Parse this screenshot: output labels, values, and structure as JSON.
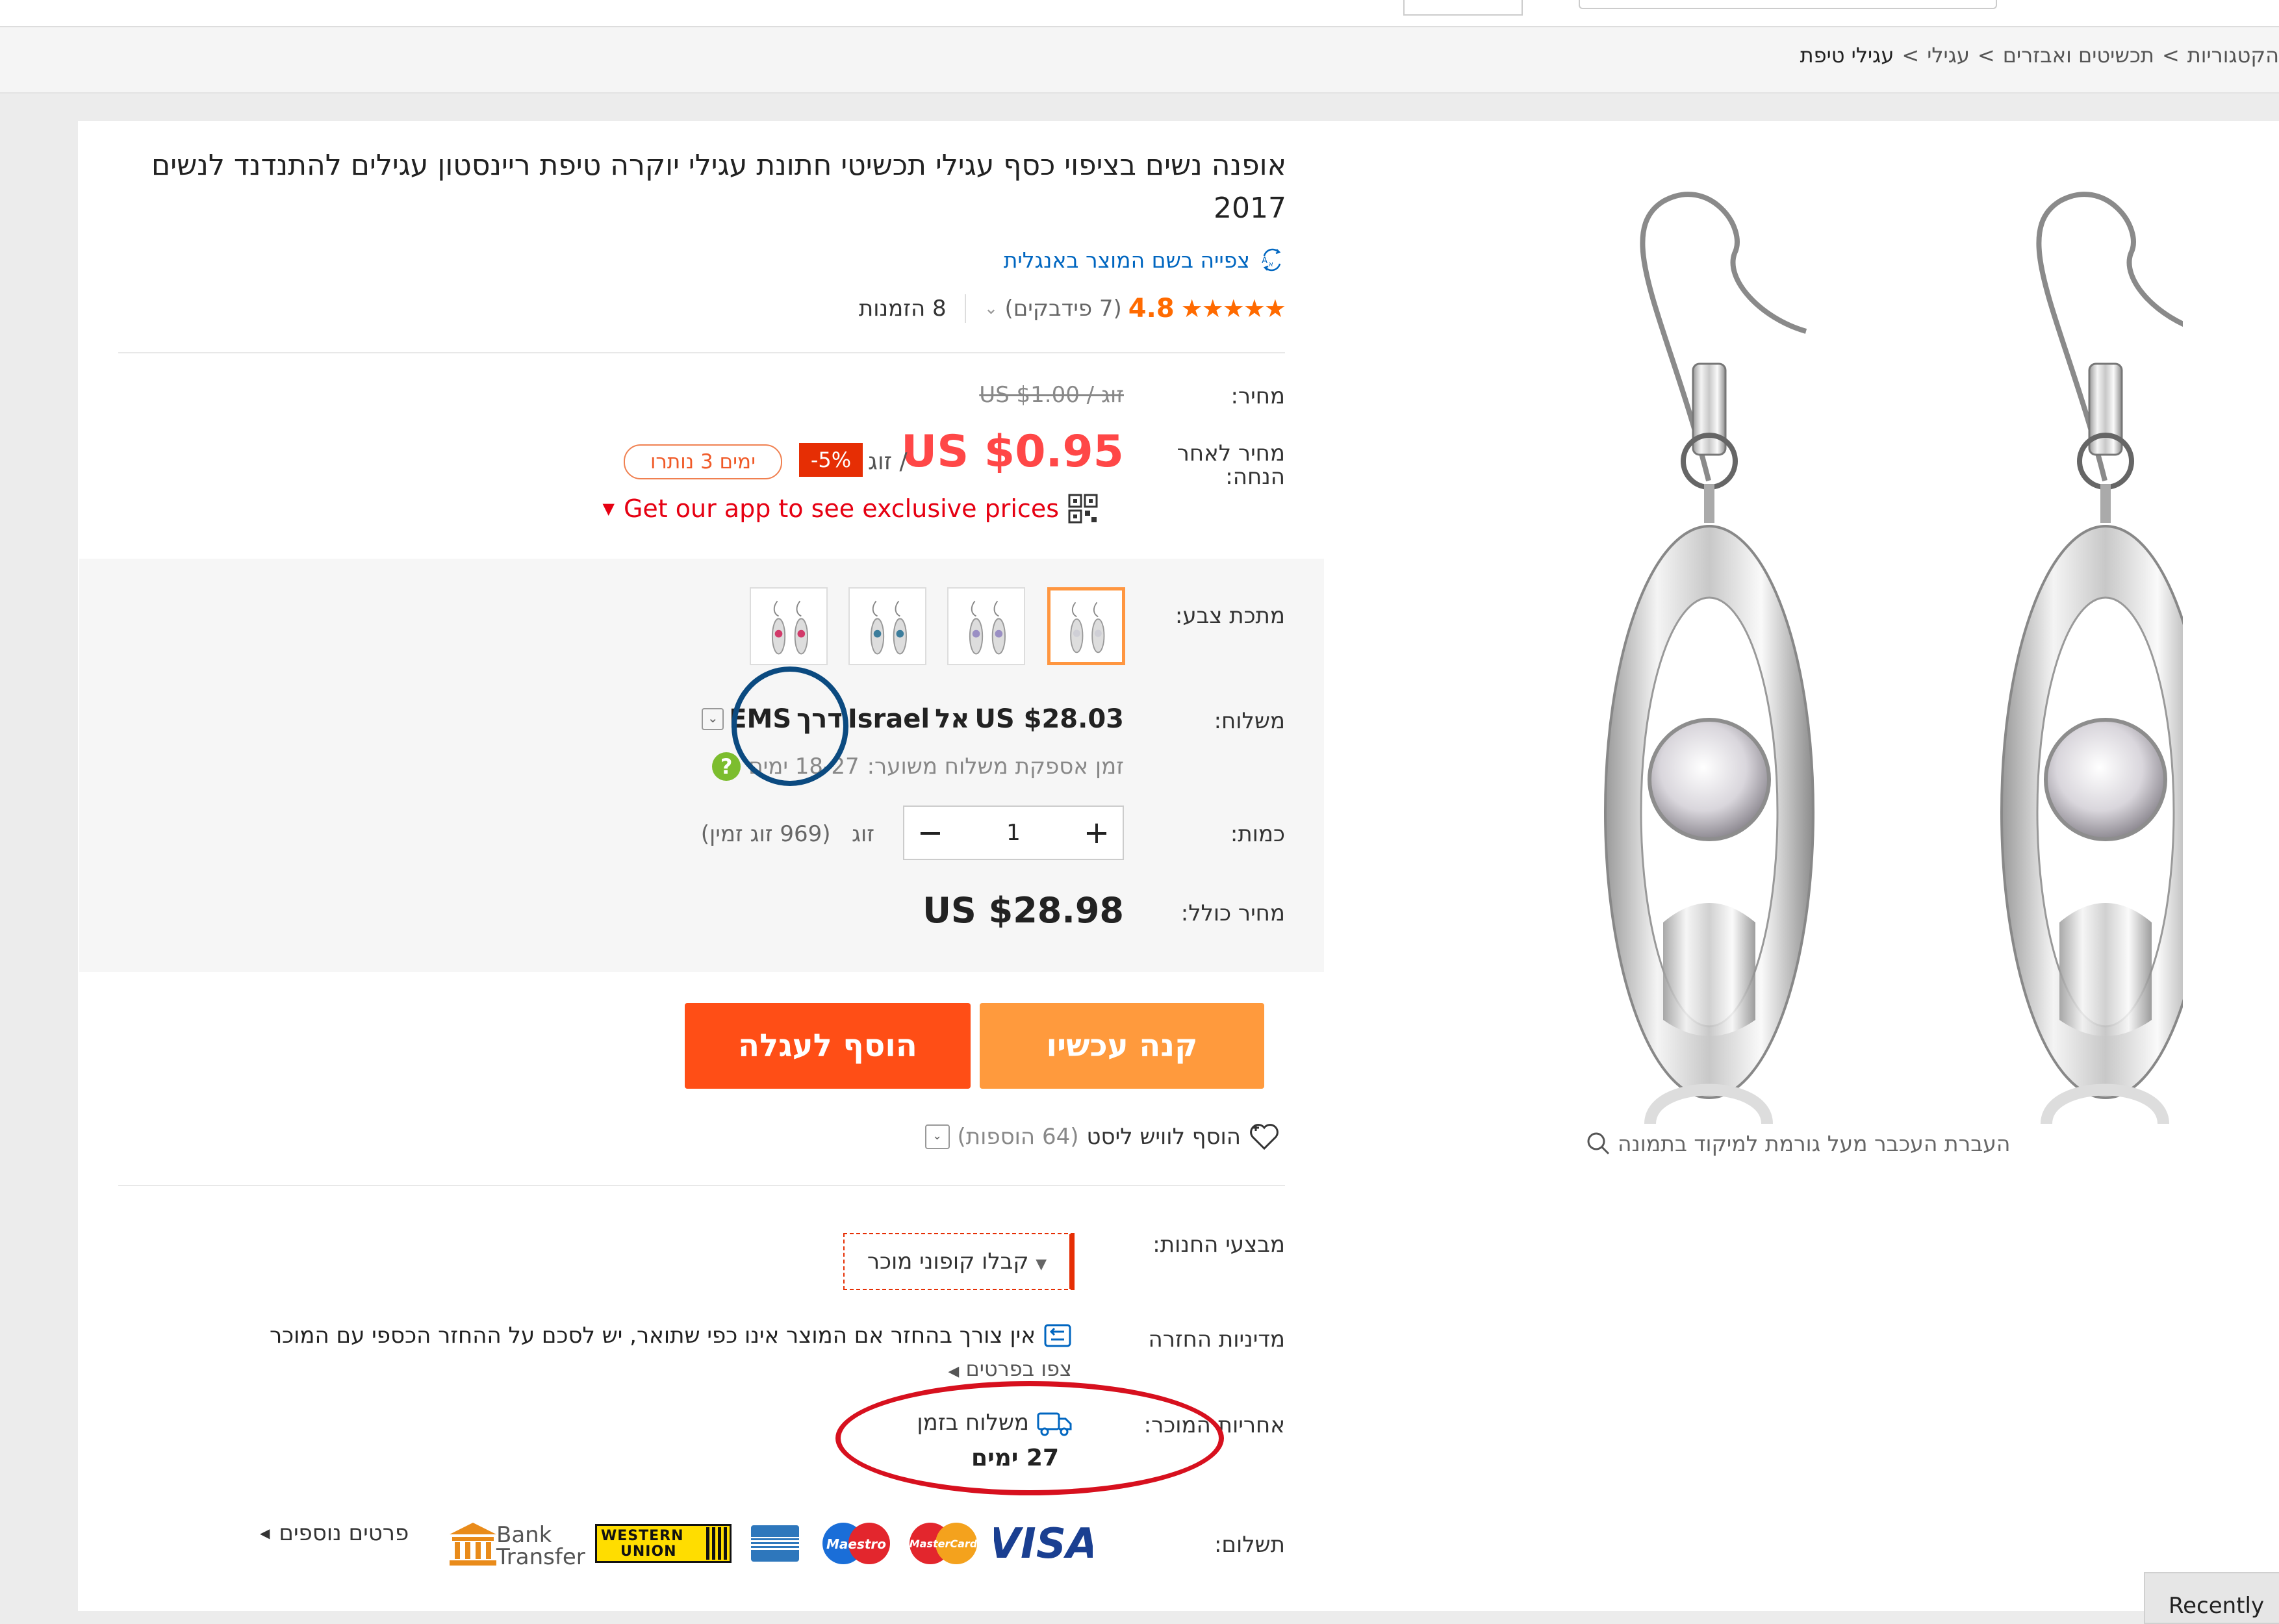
{
  "breadcrumb": {
    "items": [
      "הקטגוריות",
      "תכשיטים ואבזרים",
      "עגילי",
      "עגילי טיפת"
    ],
    "separator": ">"
  },
  "product": {
    "title": "אופנה נשים בציפוי כסף עגילי תכשיטי חתונת עגילי יוקרה טיפת ריינסטון עגילים להתנדנד לנשים 2017",
    "translate_link": "צפייה בשם המוצר באנגלית",
    "rating": {
      "stars": 4.8,
      "stars_glyph": "★★★★★",
      "score": "4.8",
      "feedback": "(7 פידבקים)",
      "orders": "8 הזמנות"
    }
  },
  "price": {
    "label": "מחיר:",
    "original": "US $1.00 / זוג",
    "discount_label": "מחיר לאחר הנחה:",
    "current": "US $0.95",
    "per_unit": "/ זוג",
    "discount_badge": "-5%",
    "days_left": "ימים 3 נותרו",
    "app_promo": "Get our app to see exclusive prices"
  },
  "color": {
    "label": "מתכת צבע:",
    "swatches": [
      {
        "name": "clear",
        "stone": "#cfcfd6",
        "selected": true
      },
      {
        "name": "purple",
        "stone": "#9a8fc4",
        "selected": false
      },
      {
        "name": "blue",
        "stone": "#3c7d9c",
        "selected": false
      },
      {
        "name": "pink",
        "stone": "#d23a6a",
        "selected": false
      }
    ]
  },
  "shipping": {
    "label": "משלוח:",
    "cost": "US $28.03",
    "to_prefix": "אל",
    "destination": "Israel",
    "via_prefix": "דרך",
    "method": "EMS",
    "time_label": "זמן אספקת משלוח משוער:",
    "time_value": "18-27 ימים"
  },
  "quantity": {
    "label": "כמות:",
    "value": "1",
    "unit": "זוג",
    "available": "(969 זוג זמין)",
    "minus": "−",
    "plus": "+"
  },
  "total": {
    "label": "מחיר כולל:",
    "value": "US $28.98"
  },
  "actions": {
    "buy_now": "קנה עכשיו",
    "add_to_cart": "הוסף לעגלה",
    "wishlist": "הוסף לוויש ליסט",
    "wishlist_count": "(64 הוספות)"
  },
  "store_promos": {
    "label": "מבצעי החנות:",
    "coupon_button": "קבלו קופוני מוכר"
  },
  "return_policy": {
    "label": "מדיניות החזרה",
    "text": "אין צורך בהחזר אם המוצר אינו כפי שתואר, יש לסכם על ההחזר הכספי עם המוכר",
    "details_link": "צפו בפרטים"
  },
  "seller_guarantee": {
    "label": "אחריות המוכר:",
    "text": "משלוח בזמן",
    "days": "27 ימים"
  },
  "payment": {
    "label": "תשלום:",
    "more_link": "פרטים נוספים",
    "methods": [
      "VISA",
      "MasterCard",
      "Maestro",
      "American Express",
      "WESTERN UNION",
      "Bank Transfer"
    ],
    "bank_line1": "Bank",
    "bank_line2": "Transfer",
    "wu_line1": "WESTERN",
    "wu_line2": "UNION"
  },
  "gallery": {
    "zoom_hint": "העברת העכבר מעל גורמת למיקוד בתמונה"
  },
  "recently_viewed": "Recently",
  "annotations": {
    "blue_circle_color": "#0b4a80",
    "red_ellipse_color": "#d7101e"
  },
  "colors": {
    "accent_orange": "#ff9a3d",
    "cart_red": "#ff4e16",
    "price_red": "#ff4747",
    "star_orange": "#ff6a00",
    "link_blue": "#0066c0"
  }
}
